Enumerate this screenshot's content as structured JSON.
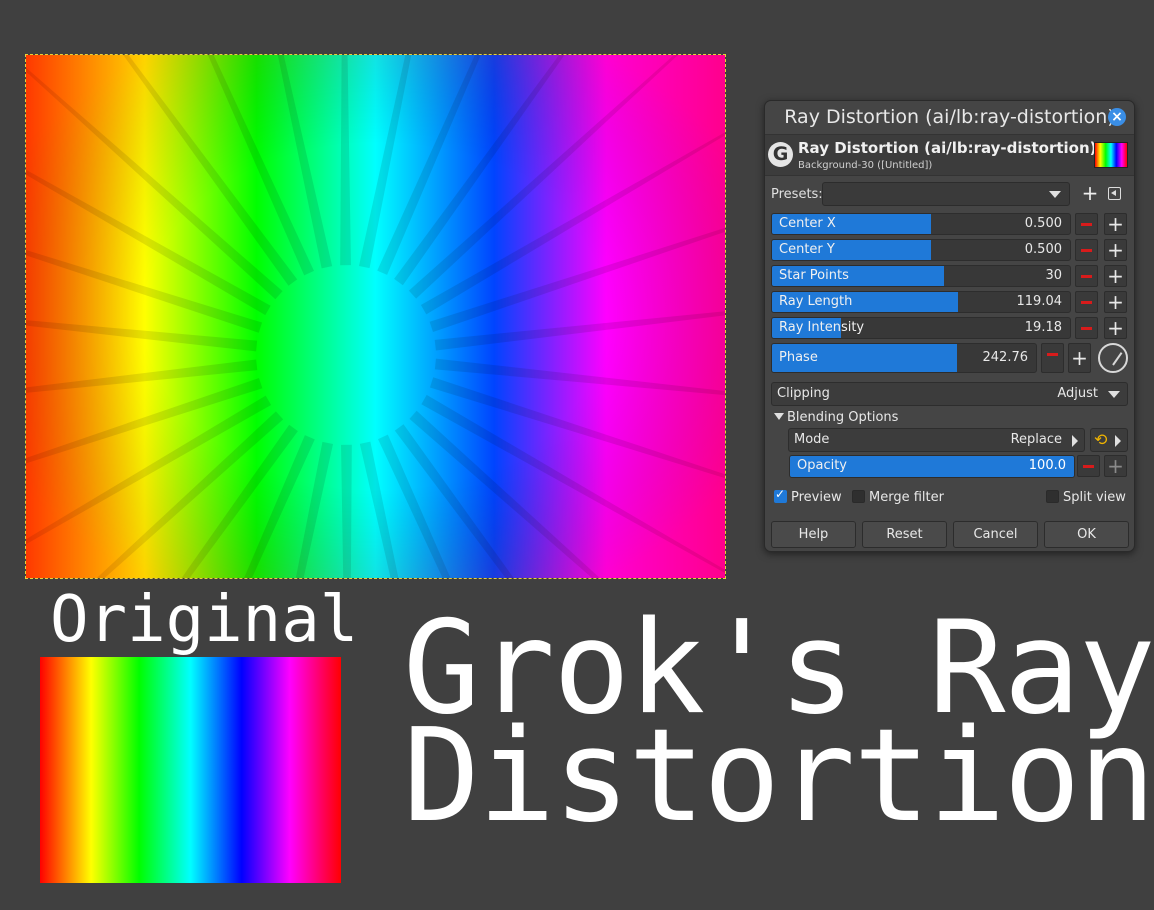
{
  "canvas": {
    "image_name": "ray-distorted-image"
  },
  "labels": {
    "original": "Original",
    "title_line1": "Grok's Ray",
    "title_line2": "Distortion"
  },
  "dialog": {
    "window_title": "Ray Distortion (ai/lb:ray-distortion)",
    "header_title": "Ray Distortion (ai/lb:ray-distortion)",
    "header_subtitle": "Background-30 ([Untitled])",
    "presets_label": "Presets:",
    "presets_value": "",
    "params": [
      {
        "label": "Center X",
        "value": "0.500",
        "fill": 0.52
      },
      {
        "label": "Center Y",
        "value": "0.500",
        "fill": 0.52
      },
      {
        "label": "Star Points",
        "value": "30",
        "fill": 0.56
      },
      {
        "label": "Ray Length",
        "value": "119.04",
        "fill": 0.61
      },
      {
        "label": "Ray Intensity",
        "value": "19.18",
        "fill": 0.23
      },
      {
        "label": "Phase",
        "value": "242.76",
        "fill": 0.69
      }
    ],
    "clipping": {
      "label": "Clipping",
      "value": "Adjust"
    },
    "blending_label": "Blending Options",
    "mode": {
      "label": "Mode",
      "value": "Replace"
    },
    "opacity": {
      "label": "Opacity",
      "value": "100.0",
      "fill": 1.0
    },
    "checks": {
      "preview": {
        "label": "Preview",
        "checked": true
      },
      "merge": {
        "label": "Merge filter",
        "checked": false
      },
      "split": {
        "label": "Split view",
        "checked": false
      }
    },
    "buttons": {
      "help": "Help",
      "reset": "Reset",
      "cancel": "Cancel",
      "ok": "OK"
    }
  },
  "colors": {
    "background": "#404040",
    "accent": "#1f79d8",
    "minus": "#d81b1b"
  }
}
